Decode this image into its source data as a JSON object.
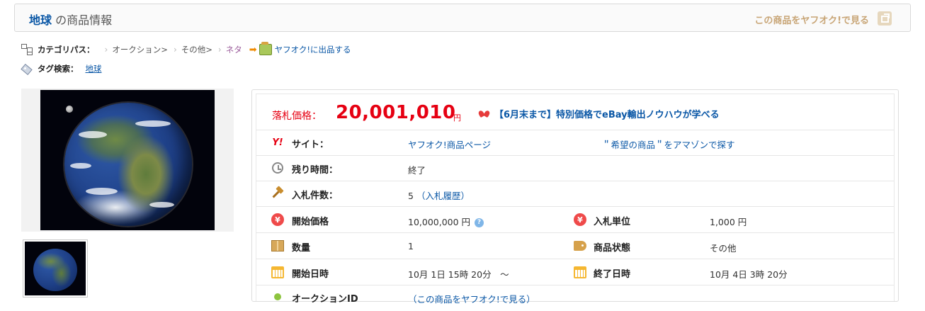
{
  "header": {
    "keyword": "地球",
    "title_rest": " の商品情報",
    "view_on_yahoo": "この商品をヤフオク!で見る",
    "view_icon": "external-window-icon"
  },
  "breadcrumb": {
    "label": "カテゴリパス：",
    "items": [
      "オークション>",
      "その他>",
      "ネタ"
    ],
    "listing_link": "ヤフオク!に出品する"
  },
  "tags": {
    "label": "タグ検索：",
    "items": [
      "地球"
    ]
  },
  "price": {
    "label": "落札価格：",
    "value": "20,001,010",
    "unit": "円",
    "promo": "【6月末まで】特別価格でeBay輸出ノウハウが学べる"
  },
  "rows": {
    "site_label": "サイト：",
    "site_link": "ヤフオク!商品ページ",
    "amazon_link": "＂希望の商品＂をアマゾンで探す",
    "remaining_label": "残り時間：",
    "remaining_value": "終了",
    "bids_label": "入札件数：",
    "bids_value": "5",
    "bids_history": "（入札履歴）",
    "start_price_label": "開始価格",
    "start_price_value": "10,000,000 円",
    "bid_unit_label": "入札単位",
    "bid_unit_value": "1,000 円",
    "quantity_label": "数量",
    "quantity_value": "1",
    "condition_label": "商品状態",
    "condition_value": "その他",
    "start_date_label": "開始日時",
    "start_date_value": "10月 1日 15時 20分　～",
    "end_date_label": "終了日時",
    "end_date_value": "10月 4日 3時 20分",
    "auction_id_label": "オークションID",
    "auction_id_value": "（この商品をヤフオク!で見る）"
  },
  "colors": {
    "brand_blue": "#0a57a6",
    "price_red": "#e60012",
    "header_link": "#c8a576"
  }
}
